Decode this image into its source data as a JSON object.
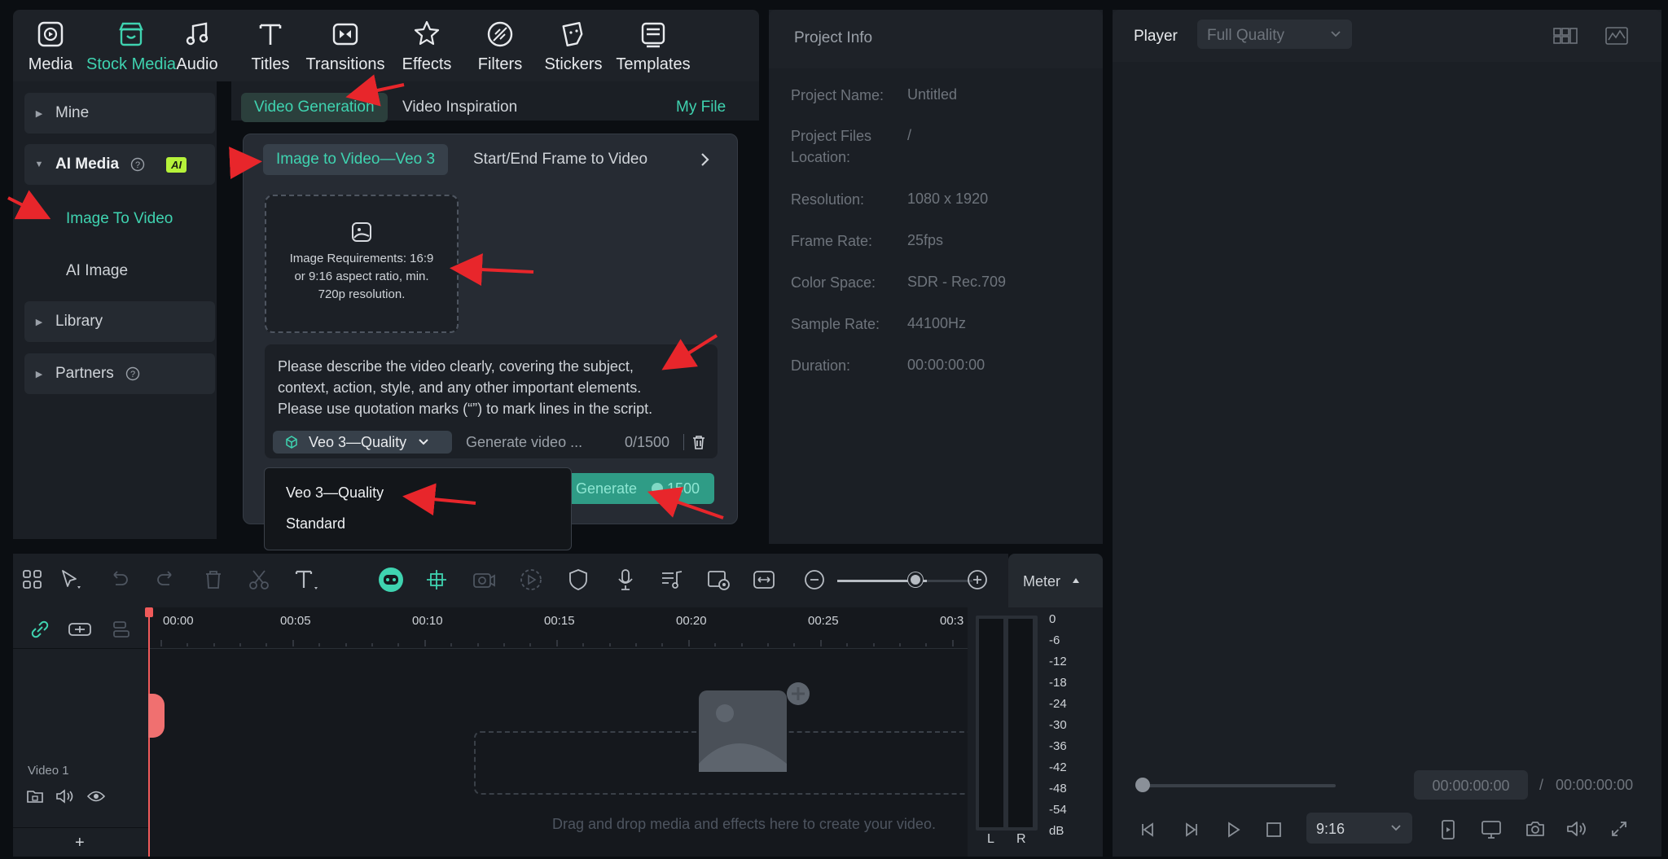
{
  "toolbar": {
    "items": [
      {
        "label": "Media",
        "icon": "media-icon"
      },
      {
        "label": "Stock Media",
        "icon": "stock-media-icon"
      },
      {
        "label": "Audio",
        "icon": "audio-icon"
      },
      {
        "label": "Titles",
        "icon": "titles-icon"
      },
      {
        "label": "Transitions",
        "icon": "transitions-icon"
      },
      {
        "label": "Effects",
        "icon": "effects-icon"
      },
      {
        "label": "Filters",
        "icon": "filters-icon"
      },
      {
        "label": "Stickers",
        "icon": "stickers-icon"
      },
      {
        "label": "Templates",
        "icon": "templates-icon"
      }
    ],
    "active": "Stock Media"
  },
  "sidebar": {
    "mine": "Mine",
    "ai_media": "AI Media",
    "ai_badge": "AI",
    "image_to_video": "Image To Video",
    "ai_image": "AI Image",
    "library": "Library",
    "partners": "Partners"
  },
  "tabs": {
    "video_generation": "Video Generation",
    "video_inspiration": "Video Inspiration",
    "my_file": "My File"
  },
  "generator": {
    "mode_active": "Image to Video—Veo 3",
    "mode_other": "Start/End Frame to Video",
    "image_requirements": [
      "Image Requirements: 16:9",
      "or 9:16 aspect ratio, min.",
      "720p resolution."
    ],
    "prompt_placeholder": [
      "Please describe the video clearly, covering the subject,",
      "context, action, style, and any other important elements.",
      "Please use quotation marks (“”) to mark lines in the script."
    ],
    "model_selected": "Veo 3—Quality",
    "generate_hint": "Generate video ...",
    "char_count": "0/1500",
    "generate_label": "Generate",
    "generate_cost": "1500"
  },
  "model_dropdown": {
    "options": [
      "Veo 3—Quality",
      "Standard"
    ]
  },
  "project_info": {
    "title": "Project Info",
    "rows": [
      {
        "key": "Project Name:",
        "value": "Untitled"
      },
      {
        "key": "Project Files Location:",
        "value": "/"
      },
      {
        "key": "Resolution:",
        "value": "1080 x 1920"
      },
      {
        "key": "Frame Rate:",
        "value": "25fps"
      },
      {
        "key": "Color Space:",
        "value": "SDR - Rec.709"
      },
      {
        "key": "Sample Rate:",
        "value": "44100Hz"
      },
      {
        "key": "Duration:",
        "value": "00:00:00:00"
      }
    ]
  },
  "player": {
    "title": "Player",
    "quality": "Full Quality",
    "current_time": "00:00:00:00",
    "separator": "/",
    "total_time": "00:00:00:00",
    "aspect": "9:16"
  },
  "timeline": {
    "ticks": [
      "00:00",
      "00:05",
      "00:10",
      "00:15",
      "00:20",
      "00:25",
      "00:3"
    ],
    "track_name": "Video 1",
    "drop_hint": "Drag and drop media and effects here to create your video.",
    "zoom_level": 0.78
  },
  "meter": {
    "label": "Meter",
    "scale": [
      "0",
      "-6",
      "-12",
      "-18",
      "-24",
      "-30",
      "-36",
      "-42",
      "-48",
      "-54",
      "dB"
    ],
    "channels": [
      "L",
      "R"
    ]
  },
  "colors": {
    "accent": "#3fd3b0",
    "annotation_arrow": "#e8262b"
  }
}
